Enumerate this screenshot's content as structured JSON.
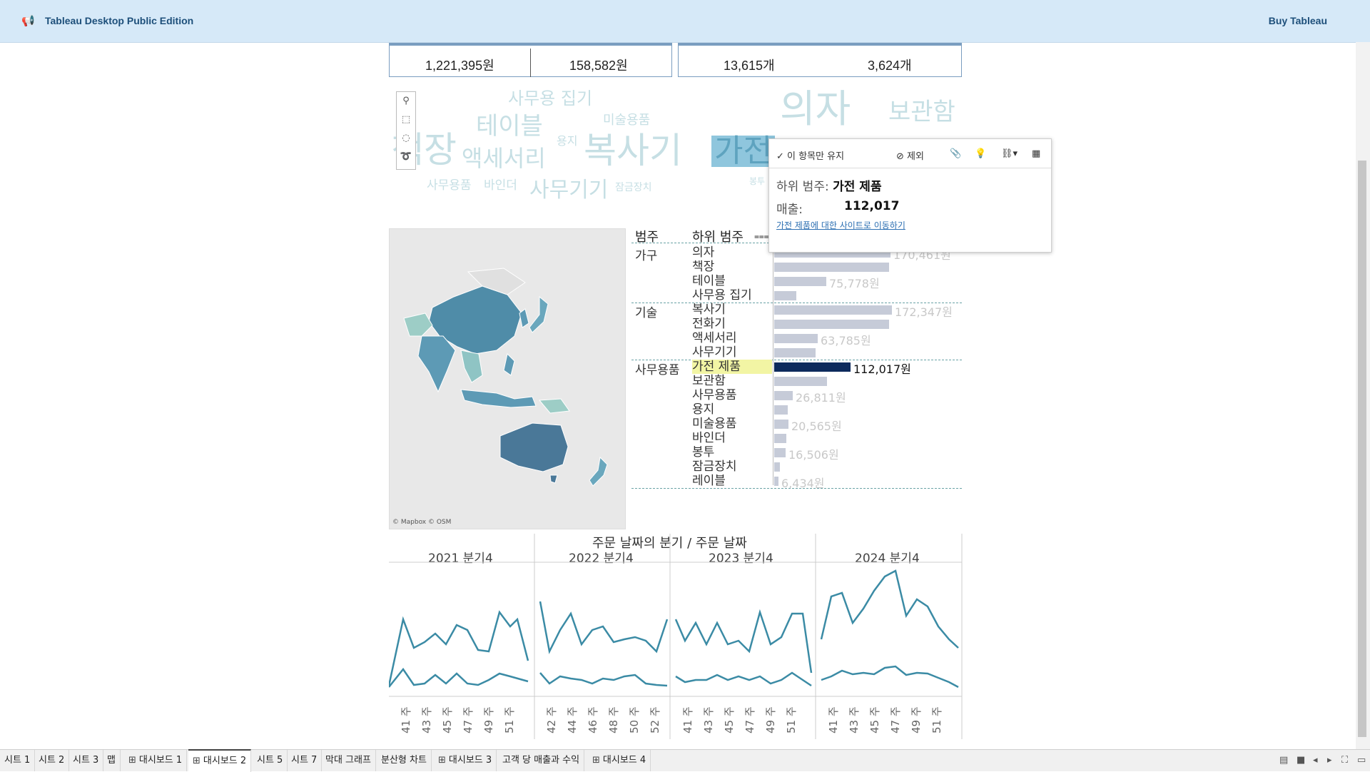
{
  "app": {
    "title": "Tableau Desktop Public Edition",
    "buy_label": "Buy Tableau"
  },
  "kpis": {
    "sales": "1,221,395원",
    "profit": "158,582원",
    "quantity": "13,615개",
    "orders": "3,624개"
  },
  "word_cloud": {
    "words": [
      "사무용 집기",
      "의자",
      "보관함",
      "테이블",
      "미술용품",
      "책장",
      "액세서리",
      "용지",
      "복사기",
      "가전",
      "봉투",
      "사무용품",
      "바인더",
      "사무기기",
      "잠금장치",
      "레이블"
    ]
  },
  "map": {
    "credit": "© Mapbox © OSM"
  },
  "table": {
    "header_category": "범주",
    "header_subcategory": "하위 범주",
    "groups": [
      {
        "category": "가구",
        "rows": [
          {
            "sub": "의자",
            "value": 170461,
            "label": "170,461원"
          },
          {
            "sub": "책장",
            "value": 168000,
            "label": ""
          },
          {
            "sub": "테이블",
            "value": 75778,
            "label": "75,778원"
          },
          {
            "sub": "사무용 집기",
            "value": 32000,
            "label": ""
          }
        ]
      },
      {
        "category": "기술",
        "rows": [
          {
            "sub": "복사기",
            "value": 172347,
            "label": "172,347원"
          },
          {
            "sub": "전화기",
            "value": 168000,
            "label": ""
          },
          {
            "sub": "액세서리",
            "value": 63785,
            "label": "63,785원"
          },
          {
            "sub": "사무기기",
            "value": 61000,
            "label": ""
          }
        ]
      },
      {
        "category": "사무용품",
        "rows": [
          {
            "sub": "가전 제품",
            "value": 112017,
            "label": "112,017원",
            "selected": true
          },
          {
            "sub": "보관함",
            "value": 77000,
            "label": ""
          },
          {
            "sub": "사무용품",
            "value": 26811,
            "label": "26,811원"
          },
          {
            "sub": "용지",
            "value": 20000,
            "label": ""
          },
          {
            "sub": "미술용품",
            "value": 20565,
            "label": "20,565원"
          },
          {
            "sub": "바인더",
            "value": 18000,
            "label": ""
          },
          {
            "sub": "봉투",
            "value": 16506,
            "label": "16,506원"
          },
          {
            "sub": "잠금장치",
            "value": 8500,
            "label": ""
          },
          {
            "sub": "레이블",
            "value": 6434,
            "label": "6,434원"
          }
        ]
      }
    ]
  },
  "tooltip": {
    "keep_only": "✓ 이 항목만 유지",
    "exclude": "⊘ 제외",
    "sub_label": "하위 범주:",
    "sub_value": "가전 제품",
    "sales_label": "매출:",
    "sales_value": "112,017",
    "link": "가전 제품에 대한 사이트로 이동하기"
  },
  "line_chart": {
    "title": "주문 날짜의 분기 / 주문 날짜",
    "panels": [
      {
        "year": "2021 분기4",
        "ticks": [
          "41 주",
          "43 주",
          "45 주",
          "47 주",
          "49 주",
          "51 주"
        ]
      },
      {
        "year": "2022 분기4",
        "ticks": [
          "42 주",
          "44 주",
          "46 주",
          "48 주",
          "50 주",
          "52 주"
        ]
      },
      {
        "year": "2023 분기4",
        "ticks": [
          "41 주",
          "43 주",
          "45 주",
          "47 주",
          "49 주",
          "51 주"
        ]
      },
      {
        "year": "2024 분기4",
        "ticks": [
          "41 주",
          "43 주",
          "45 주",
          "47 주",
          "49 주",
          "51 주"
        ]
      }
    ]
  },
  "tabs": [
    {
      "label": "시트 1",
      "icon": ""
    },
    {
      "label": "시트 2",
      "icon": ""
    },
    {
      "label": "시트 3",
      "icon": ""
    },
    {
      "label": "맵",
      "icon": ""
    },
    {
      "label": "대시보드 1",
      "icon": "dashboard-icon"
    },
    {
      "label": "대시보드 2",
      "icon": "dashboard-icon",
      "active": true
    },
    {
      "label": "시트 5",
      "icon": ""
    },
    {
      "label": "시트 7",
      "icon": ""
    },
    {
      "label": "막대 그래프",
      "icon": ""
    },
    {
      "label": "분산형 차트",
      "icon": ""
    },
    {
      "label": "대시보드 3",
      "icon": "dashboard-icon"
    },
    {
      "label": "고객 당 매출과 수익",
      "icon": ""
    },
    {
      "label": "대시보드 4",
      "icon": "dashboard-icon"
    }
  ],
  "colors": {
    "accent": "#0d2a5c",
    "bar": "#c6cbd8",
    "teal": "#3b8ba5",
    "highlight": "#f2f5a4"
  }
}
